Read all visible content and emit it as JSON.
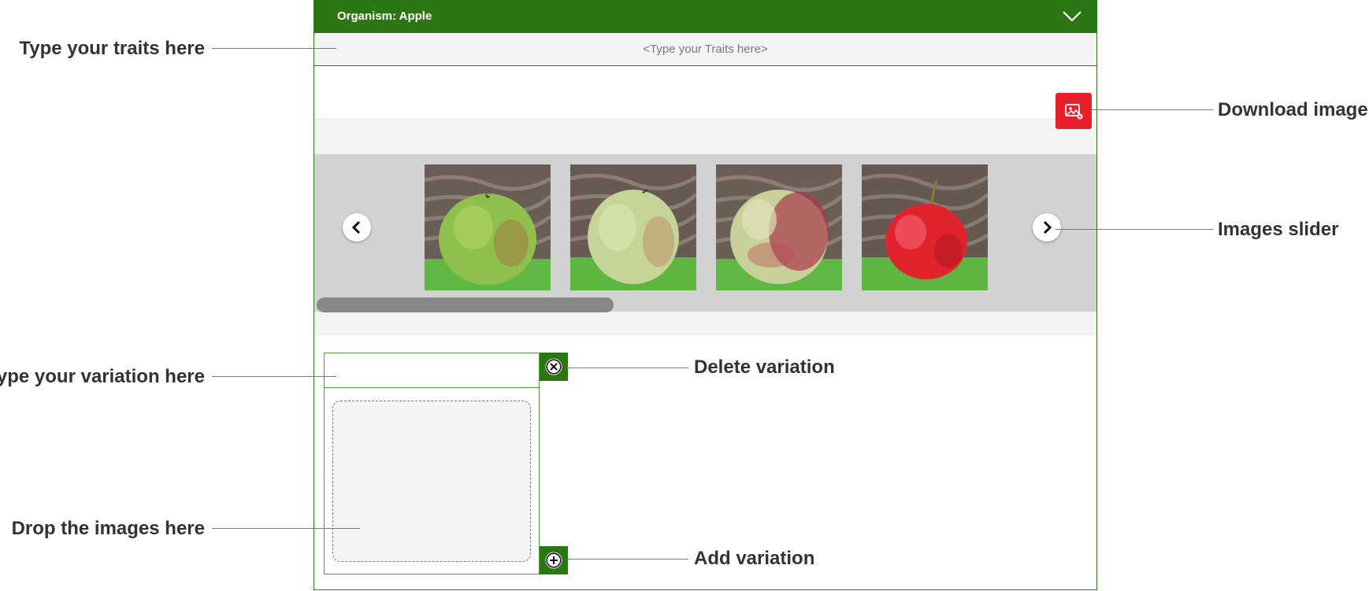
{
  "panel": {
    "header_title": "Organism: Apple",
    "traits_placeholder": "<Type your Traits here>",
    "colors": {
      "header": "#2d7614",
      "download": "#e8202a",
      "border": "#2d7a1f"
    }
  },
  "slider": {
    "images": [
      {
        "alt": "Green apple with red streaks"
      },
      {
        "alt": "Pale green apple"
      },
      {
        "alt": "Green and red apple"
      },
      {
        "alt": "Red apple with stem"
      }
    ],
    "scroll_position": 0.0
  },
  "variation": {
    "input_value": "",
    "dropzone_label": ""
  },
  "annotations": {
    "traits": "Type your traits here",
    "variation": "Type your variation here",
    "drop": "Drop the images here",
    "download": "Download images",
    "slider": "Images slider",
    "delete": "Delete variation",
    "add": "Add variation"
  },
  "icons": {
    "header_toggle": "chevron-down-icon",
    "download": "image-download-icon",
    "prev": "chevron-left-icon",
    "next": "chevron-right-icon",
    "delete": "close-circle-icon",
    "add": "plus-circle-icon"
  }
}
